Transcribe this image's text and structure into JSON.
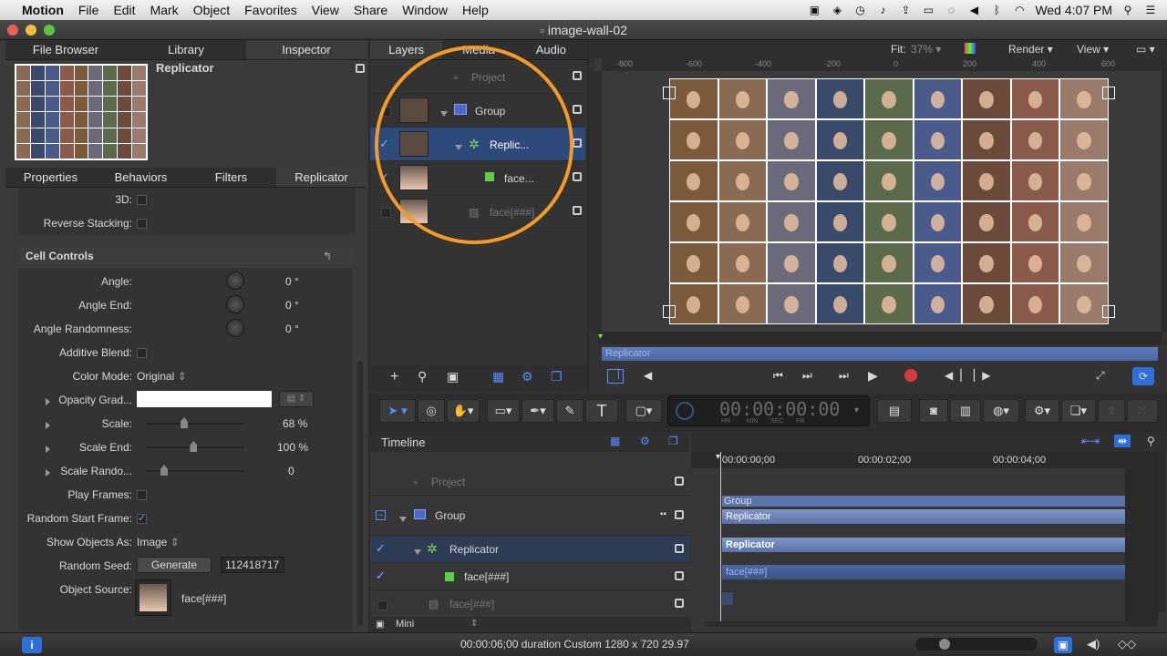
{
  "menubar": {
    "app": "Motion",
    "items": [
      "File",
      "Edit",
      "Mark",
      "Object",
      "Favorites",
      "View",
      "Share",
      "Window",
      "Help"
    ],
    "clock": "Wed 4:07 PM"
  },
  "window": {
    "title": "image-wall-02"
  },
  "left_tabs": [
    "File Browser",
    "Library",
    "Inspector"
  ],
  "inspector": {
    "object_name": "Replicator",
    "subtabs": [
      "Properties",
      "Behaviors",
      "Filters",
      "Replicator"
    ],
    "rows_top": [
      {
        "label": "3D:"
      },
      {
        "label": "Reverse Stacking:"
      }
    ],
    "section": "Cell Controls",
    "angle": {
      "label": "Angle:",
      "value": "0 °"
    },
    "angle_end": {
      "label": "Angle End:",
      "value": "0 °"
    },
    "angle_rand": {
      "label": "Angle Randomness:",
      "value": "0 °"
    },
    "additive": {
      "label": "Additive Blend:"
    },
    "color_mode": {
      "label": "Color Mode:",
      "value": "Original"
    },
    "opacity": {
      "label": "Opacity Grad..."
    },
    "scale": {
      "label": "Scale:",
      "value": "68 %",
      "fraction": 0.68
    },
    "scale_end": {
      "label": "Scale End:",
      "value": "100 %",
      "fraction": 1.0
    },
    "scale_rand": {
      "label": "Scale Rando...",
      "value": "0",
      "fraction": 0
    },
    "play_frames": {
      "label": "Play Frames:"
    },
    "random_start": {
      "label": "Random Start Frame:"
    },
    "show_as": {
      "label": "Show Objects As:",
      "value": "Image"
    },
    "seed": {
      "label": "Random Seed:",
      "button": "Generate",
      "value": "112418717"
    },
    "source": {
      "label": "Object Source:",
      "value": "face[###]"
    }
  },
  "layers_tabs": [
    "Layers",
    "Media",
    "Audio"
  ],
  "layers": [
    {
      "name": "Project"
    },
    {
      "name": "Group"
    },
    {
      "name": "Replic..."
    },
    {
      "name": "face..."
    },
    {
      "name": "face[###]"
    }
  ],
  "canvas_toolbar": {
    "fit": "Fit:",
    "fit_value": "37%",
    "render": "Render",
    "view": "View"
  },
  "ruler_ticks": [
    "-800",
    "-600",
    "-400",
    "-200",
    "0",
    "200",
    "400",
    "600"
  ],
  "miniline_label": "Replicator",
  "timecode": "00:00:00:00",
  "timecode_units": [
    "HR",
    "MIN",
    "SEC",
    "FR"
  ],
  "timeline": {
    "title": "Timeline",
    "rows": [
      {
        "name": "Project"
      },
      {
        "name": "Group"
      },
      {
        "name": "Replicator"
      },
      {
        "name": "face[###]"
      },
      {
        "name": "face[###]"
      }
    ],
    "ruler": [
      "00:00:00;00",
      "00:00:02;00",
      "00:00:04;00"
    ],
    "bars": {
      "group": "Group",
      "rep1": "Replicator",
      "rep2": "Replicator",
      "face": "face[###]"
    },
    "mini": "Mini"
  },
  "status": "00:00:06;00 duration Custom 1280 x 720 29.97"
}
